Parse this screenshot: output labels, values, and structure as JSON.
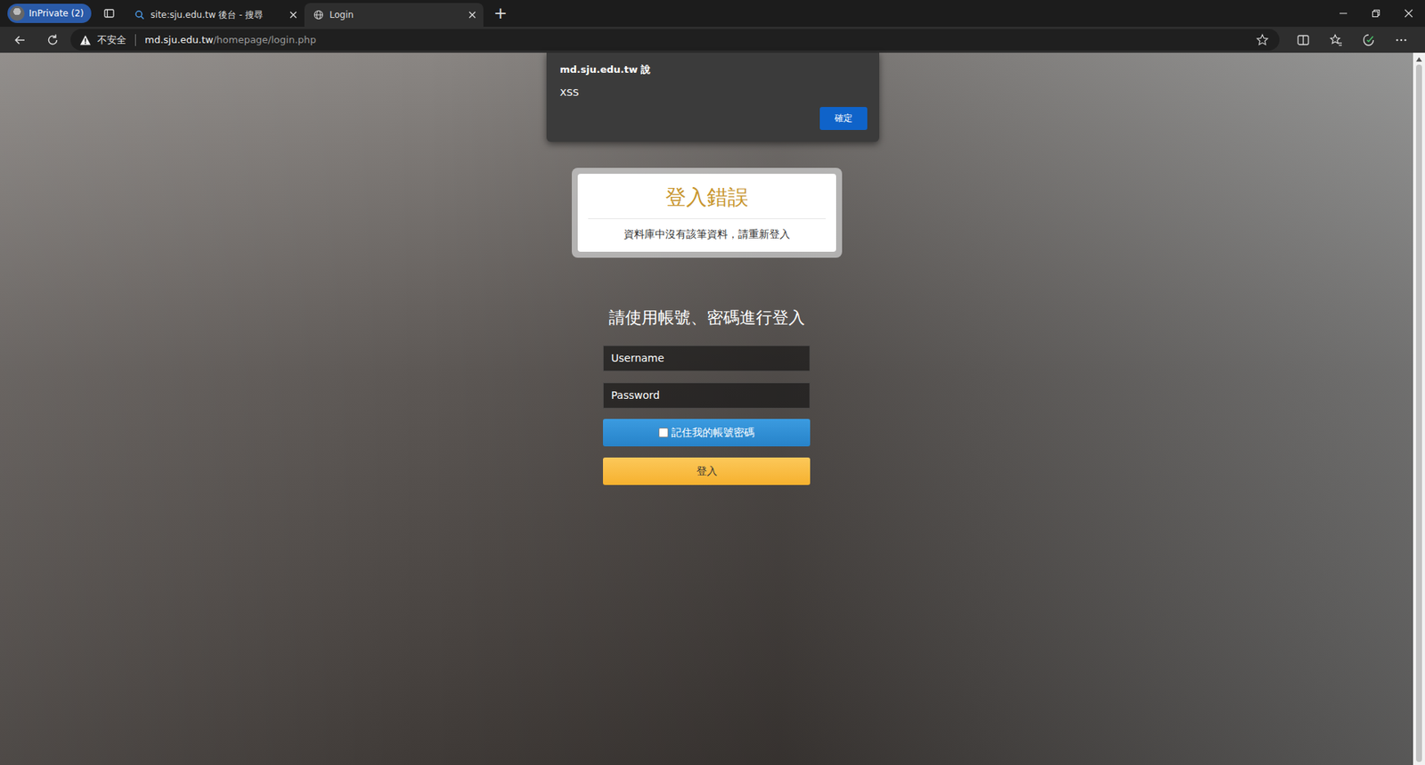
{
  "browser": {
    "inprivate": "InPrivate (2)",
    "tabs": [
      {
        "label": "site:sju.edu.tw 後台 - 搜尋",
        "selected": false,
        "icon": "search"
      },
      {
        "label": "Login",
        "selected": true,
        "icon": "globe"
      }
    ],
    "new_tab": "+",
    "security": "不安全",
    "url_host": "md.sju.edu.tw",
    "url_path": "/homepage/login.php"
  },
  "alert": {
    "title": "md.sju.edu.tw 說",
    "message": "XSS",
    "button": "確定"
  },
  "error": {
    "title": "登入錯誤",
    "message": "資料庫中沒有該筆資料，請重新登入"
  },
  "login": {
    "heading": "請使用帳號、密碼進行登入",
    "username_placeholder": "Username",
    "password_placeholder": "Password",
    "remember": {
      "label": "記住我的帳號密碼",
      "checked": false
    },
    "submit": "登入"
  }
}
